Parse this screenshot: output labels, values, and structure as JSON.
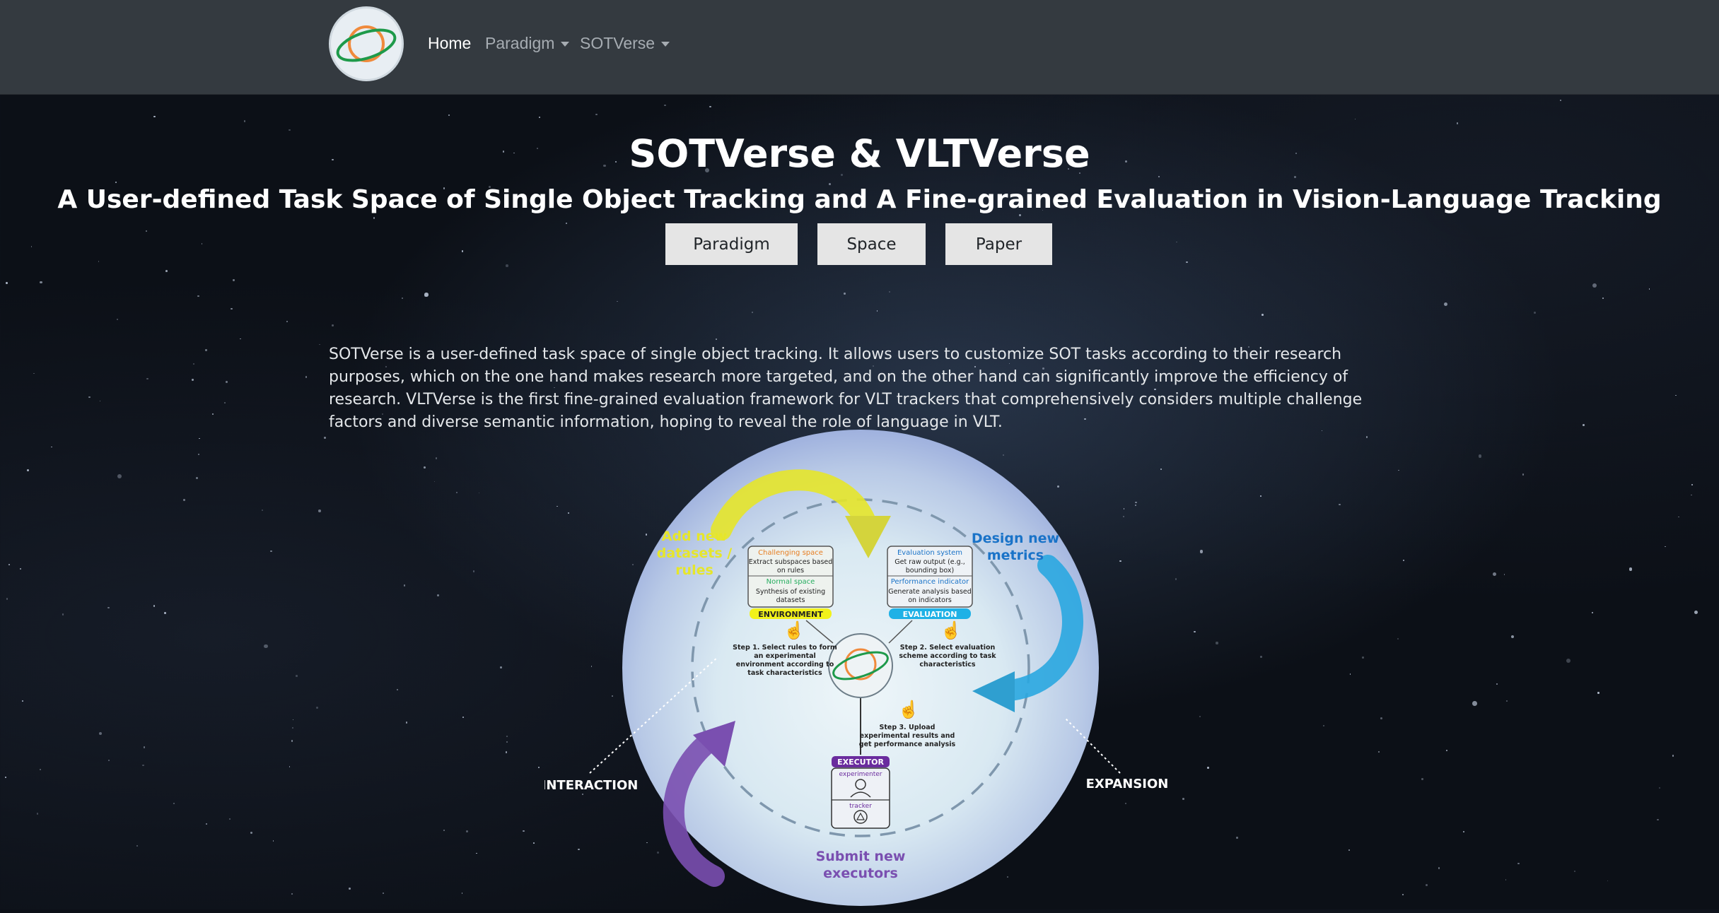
{
  "nav": {
    "links": [
      {
        "label": "Home",
        "active": true
      },
      {
        "label": "Paradigm",
        "dropdown": true
      },
      {
        "label": "SOTVerse",
        "dropdown": true
      }
    ]
  },
  "hero": {
    "title": "SOTVerse & VLTVerse",
    "subtitle": "A User-defined Task Space of Single Object Tracking and A Fine-grained Evaluation in Vision-Language Tracking",
    "buttons": [
      "Paradigm",
      "Space",
      "Paper"
    ]
  },
  "description": "SOTVerse is a user-defined task space of single object tracking. It allows users to customize SOT tasks according to their research purposes, which on the one hand makes research more targeted, and on the other hand can significantly improve the efficiency of research. VLTVerse is the first fine-grained evaluation framework for VLT trackers that comprehensively considers multiple challenge factors and diverse semantic information, hoping to reveal the role of language in VLT.",
  "figure": {
    "add_datasets": [
      "Add new",
      "datasets /",
      "rules"
    ],
    "design_metrics": [
      "Design new",
      "metrics"
    ],
    "submit_executors": [
      "Submit new",
      "executors"
    ],
    "interaction": "INTERACTION",
    "expansion": "EXPANSION",
    "environment": {
      "challenging": "Challenging space",
      "challenging_desc": [
        "Extract subspaces based",
        "on rules"
      ],
      "normal": "Normal space",
      "normal_desc": [
        "Synthesis of existing",
        "datasets"
      ],
      "label": "ENVIRONMENT"
    },
    "evaluation": {
      "system": "Evaluation system",
      "system_desc": [
        "Get raw output (e.g.,",
        "bounding box)"
      ],
      "indicator": "Performance indicator",
      "indicator_desc": [
        "Generate analysis based",
        "on indicators"
      ],
      "label": "EVALUATION"
    },
    "step1": [
      "Step 1. Select rules to form",
      "an experimental",
      "environment according to",
      "task characteristics"
    ],
    "step2": [
      "Step 2. Select evaluation",
      "scheme according to task",
      "characteristics"
    ],
    "step3": [
      "Step 3. Upload",
      "experimental results and",
      "get performance analysis"
    ],
    "executor": {
      "label": "EXECUTOR",
      "experimenter": "experimenter",
      "tracker": "tracker"
    },
    "colors": {
      "yellow": "#e6e62a",
      "blue": "#2aa7e0",
      "purple": "#7a4fb0",
      "ring": "#7f97ad"
    }
  }
}
